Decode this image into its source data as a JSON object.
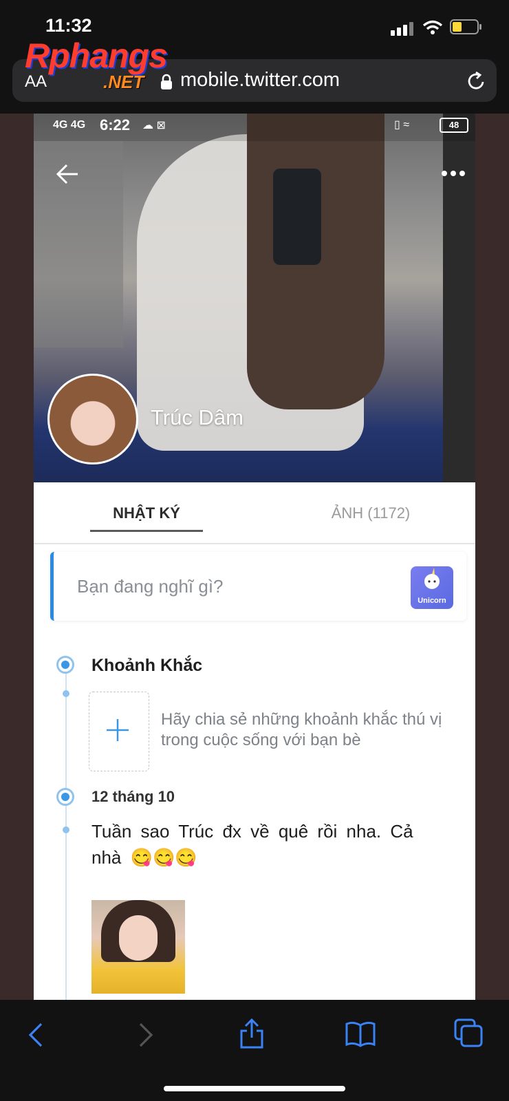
{
  "ios": {
    "time": "11:32",
    "url": "mobile.twitter.com",
    "text_size_button": "AA"
  },
  "watermark": {
    "line1": "Rphangs",
    "line2": ".NET"
  },
  "inner_status": {
    "network": "4G 4G",
    "time": "6:22",
    "battery": "48"
  },
  "profile": {
    "name": "Trúc Dâm"
  },
  "tabs": [
    {
      "label": "NHẬT KÝ",
      "active": true
    },
    {
      "label": "ẢNH (1172)",
      "active": false
    }
  ],
  "composer": {
    "placeholder": "Bạn đang nghĩ gì?",
    "badge": "Unicorn"
  },
  "moments": {
    "title": "Khoảnh Khắc",
    "prompt": "Hãy chia sẻ những khoảnh khắc thú vị trong cuộc sống với bạn bè"
  },
  "post": {
    "date": "12 tháng 10",
    "text": "Tuần sao Trúc đx về quê rồi nha. Cả nhà 😋😋😋"
  },
  "colors": {
    "accent": "#3a97e6",
    "ios_bar": "#121212",
    "ios_tint": "#3b82f6"
  }
}
